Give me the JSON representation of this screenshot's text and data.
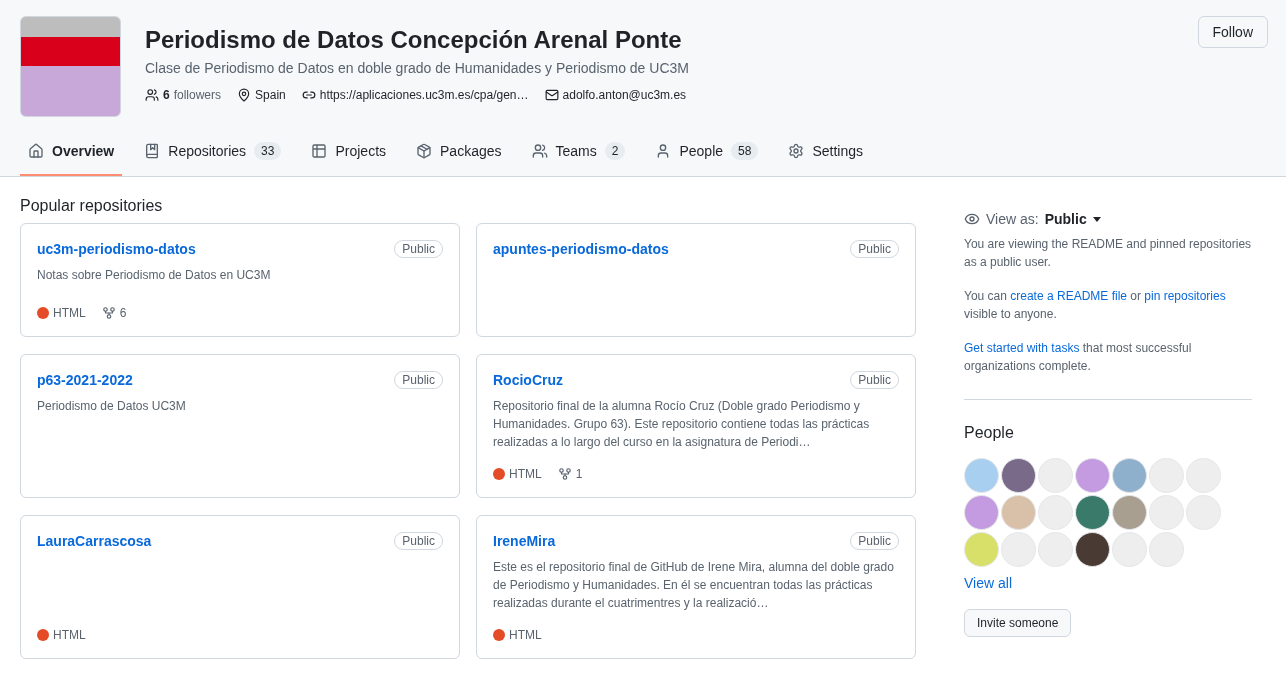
{
  "org": {
    "name": "Periodismo de Datos Concepción Arenal Ponte",
    "description": "Clase de Periodismo de Datos en doble grado de Humanidades y Periodismo de UC3M",
    "followers_count": "6",
    "followers_label": "followers",
    "location": "Spain",
    "website": "https://aplicaciones.uc3m.es/cpa/gen…",
    "email": "adolfo.anton@uc3m.es",
    "follow_button": "Follow"
  },
  "tabs": [
    {
      "kind": "home",
      "label": "Overview",
      "selected": true
    },
    {
      "kind": "repo",
      "label": "Repositories",
      "counter": "33",
      "selected": false
    },
    {
      "kind": "table",
      "label": "Projects",
      "selected": false
    },
    {
      "kind": "package",
      "label": "Packages",
      "selected": false
    },
    {
      "kind": "people",
      "label": "Teams",
      "counter": "2",
      "selected": false
    },
    {
      "kind": "person",
      "label": "People",
      "counter": "58",
      "selected": false
    },
    {
      "kind": "gear",
      "label": "Settings",
      "selected": false
    }
  ],
  "popular": {
    "title": "Popular repositories",
    "repos": [
      {
        "name": "uc3m-periodismo-datos",
        "visibility": "Public",
        "description": "Notas sobre Periodismo de Datos en UC3M",
        "language": "HTML",
        "color": "#e34c26",
        "forks": "6"
      },
      {
        "name": "apuntes-periodismo-datos",
        "visibility": "Public"
      },
      {
        "name": "p63-2021-2022",
        "visibility": "Public",
        "description": "Periodismo de Datos UC3M"
      },
      {
        "name": "RocioCruz",
        "visibility": "Public",
        "description": "Repositorio final de la alumna Rocío Cruz (Doble grado Periodismo y Humanidades. Grupo 63). Este repositorio contiene todas las prácticas realizadas a lo largo del curso en la asignatura de Periodi…",
        "language": "HTML",
        "color": "#e34c26",
        "forks": "1"
      },
      {
        "name": "LauraCarrascosa",
        "visibility": "Public",
        "language": "HTML",
        "color": "#e34c26"
      },
      {
        "name": "IreneMira",
        "visibility": "Public",
        "description": "Este es el repositorio final de GitHub de Irene Mira, alumna del doble grado de Periodismo y Humanidades. En él se encuentran todas las prácticas realizadas durante el cuatrimentres y la realizació…",
        "language": "HTML",
        "color": "#e34c26"
      }
    ]
  },
  "sidebar": {
    "view_as_label": "View as:",
    "view_as_value": "Public",
    "paragraphs": [
      [
        {
          "kind": "text",
          "text": "You are viewing the README and pinned repositories as a public user."
        }
      ],
      [
        {
          "kind": "text",
          "text": "You can "
        },
        {
          "kind": "link",
          "text": "create a README file"
        },
        {
          "kind": "text",
          "text": " or "
        },
        {
          "kind": "link",
          "text": "pin repositories"
        },
        {
          "kind": "text",
          "text": " visible to anyone."
        }
      ],
      [
        {
          "kind": "link",
          "text": "Get started with tasks"
        },
        {
          "kind": "text",
          "text": " that most successful organizations complete."
        }
      ]
    ],
    "people_title": "People",
    "view_all": "View all",
    "invite_button": "Invite someone"
  }
}
